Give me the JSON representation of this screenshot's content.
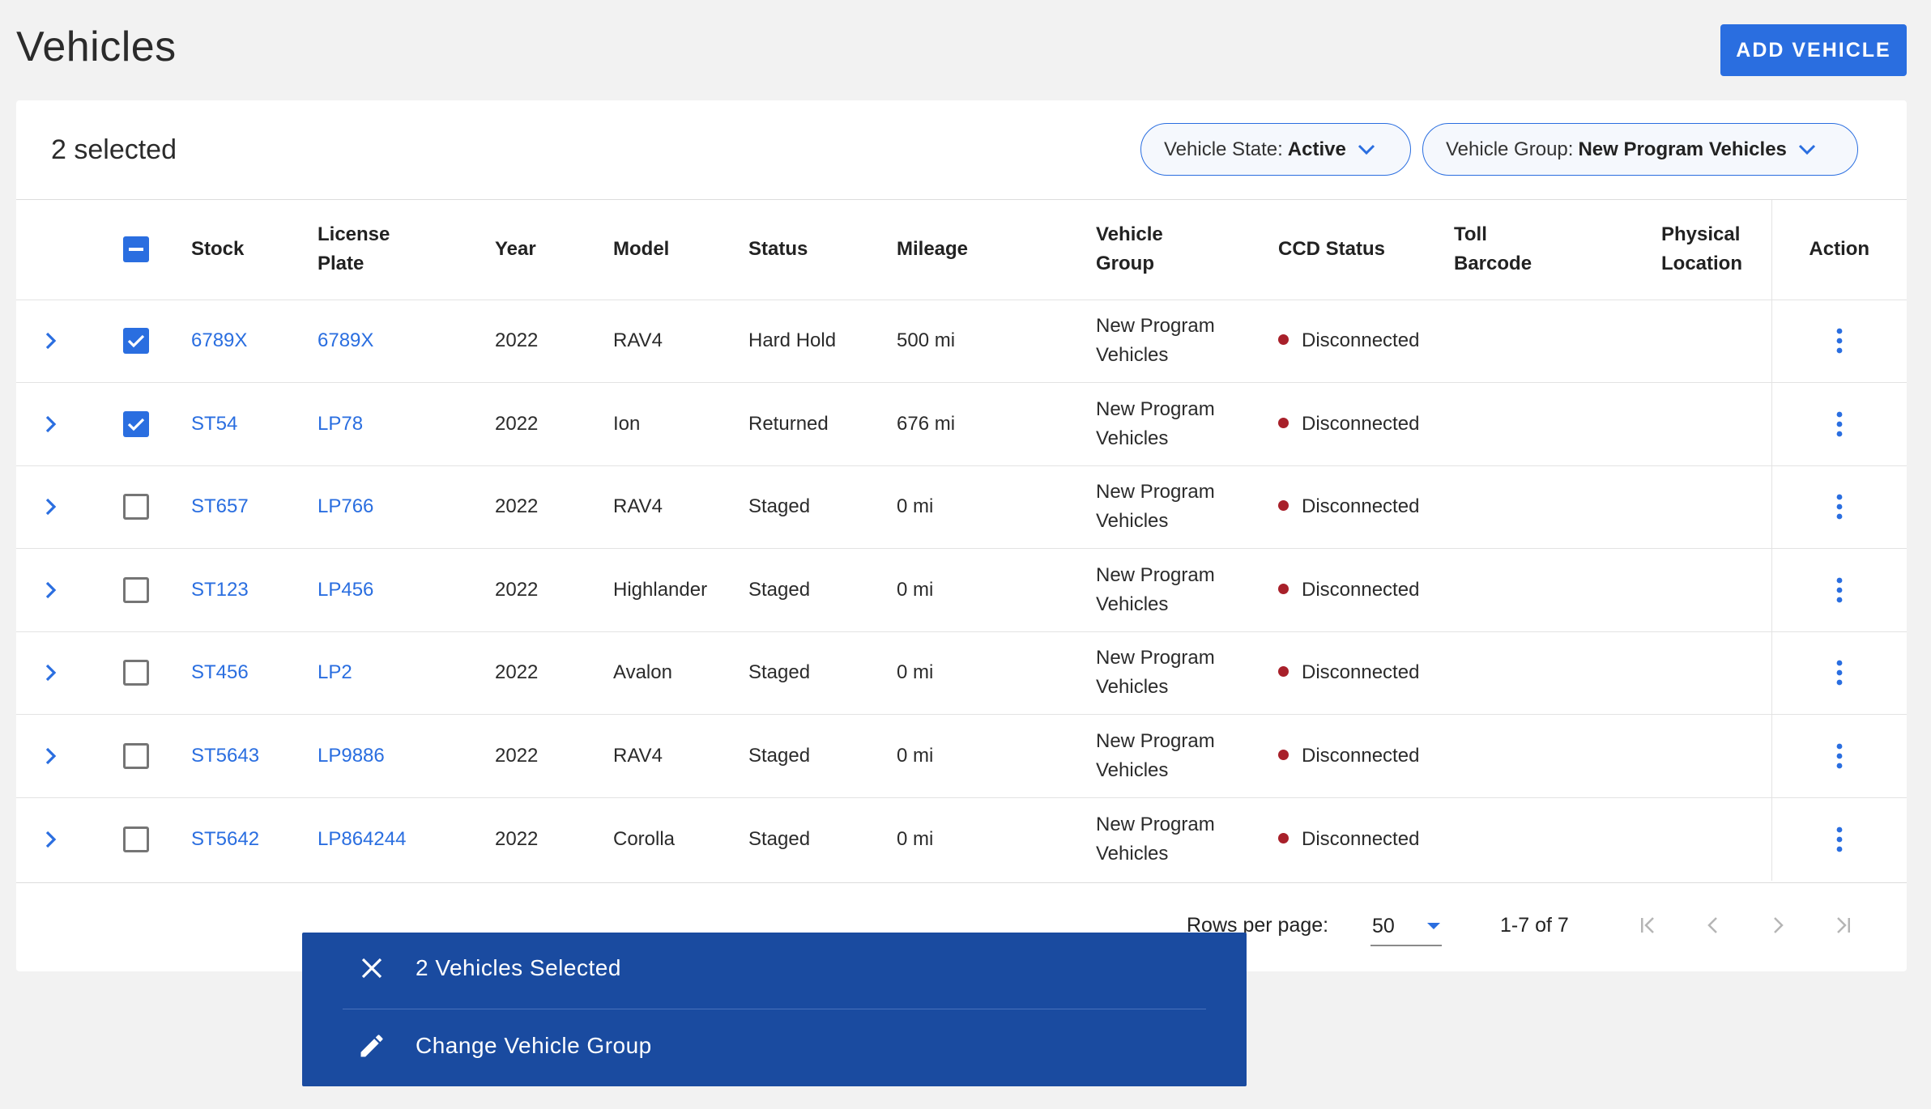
{
  "header": {
    "title": "Vehicles",
    "add_button_label": "ADD VEHICLE"
  },
  "toolbar": {
    "selected_count": "2 selected",
    "filters": [
      {
        "label": "Vehicle State:",
        "value": "Active"
      },
      {
        "label": "Vehicle Group:",
        "value": "New Program Vehicles"
      }
    ]
  },
  "table": {
    "columns": {
      "stock": "Stock",
      "license_plate_1": "License",
      "license_plate_2": "Plate",
      "year": "Year",
      "model": "Model",
      "status": "Status",
      "mileage": "Mileage",
      "vehicle_group_1": "Vehicle",
      "vehicle_group_2": "Group",
      "ccd_status": "CCD Status",
      "toll_barcode_1": "Toll",
      "toll_barcode_2": "Barcode",
      "physical_location_1": "Physical",
      "physical_location_2": "Location",
      "action": "Action"
    },
    "rows": [
      {
        "stock": "6789X",
        "plate": "6789X",
        "year": "2022",
        "model": "RAV4",
        "status": "Hard Hold",
        "mileage": "500 mi",
        "group_1": "New Program",
        "group_2": "Vehicles",
        "ccd": "Disconnected",
        "selected": true
      },
      {
        "stock": "ST54",
        "plate": "LP78",
        "year": "2022",
        "model": "Ion",
        "status": "Returned",
        "mileage": "676 mi",
        "group_1": "New Program",
        "group_2": "Vehicles",
        "ccd": "Disconnected",
        "selected": true
      },
      {
        "stock": "ST657",
        "plate": "LP766",
        "year": "2022",
        "model": "RAV4",
        "status": "Staged",
        "mileage": "0 mi",
        "group_1": "New Program",
        "group_2": "Vehicles",
        "ccd": "Disconnected",
        "selected": false
      },
      {
        "stock": "ST123",
        "plate": "LP456",
        "year": "2022",
        "model": "Highlander",
        "status": "Staged",
        "mileage": "0 mi",
        "group_1": "New Program",
        "group_2": "Vehicles",
        "ccd": "Disconnected",
        "selected": false
      },
      {
        "stock": "ST456",
        "plate": "LP2",
        "year": "2022",
        "model": "Avalon",
        "status": "Staged",
        "mileage": "0 mi",
        "group_1": "New Program",
        "group_2": "Vehicles",
        "ccd": "Disconnected",
        "selected": false
      },
      {
        "stock": "ST5643",
        "plate": "LP9886",
        "year": "2022",
        "model": "RAV4",
        "status": "Staged",
        "mileage": "0 mi",
        "group_1": "New Program",
        "group_2": "Vehicles",
        "ccd": "Disconnected",
        "selected": false
      },
      {
        "stock": "ST5642",
        "plate": "LP864244",
        "year": "2022",
        "model": "Corolla",
        "status": "Staged",
        "mileage": "0 mi",
        "group_1": "New Program",
        "group_2": "Vehicles",
        "ccd": "Disconnected",
        "selected": false
      }
    ]
  },
  "pagination": {
    "rows_per_page_label": "Rows per page:",
    "rows_per_page_value": "50",
    "range": "1-7 of 7"
  },
  "action_bar": {
    "selected_label": "2 Vehicles Selected",
    "change_group_label": "Change Vehicle Group"
  },
  "colors": {
    "accent": "#2a6ee0",
    "action_bar": "#1a4ba0",
    "disconnected": "#a8202a"
  }
}
